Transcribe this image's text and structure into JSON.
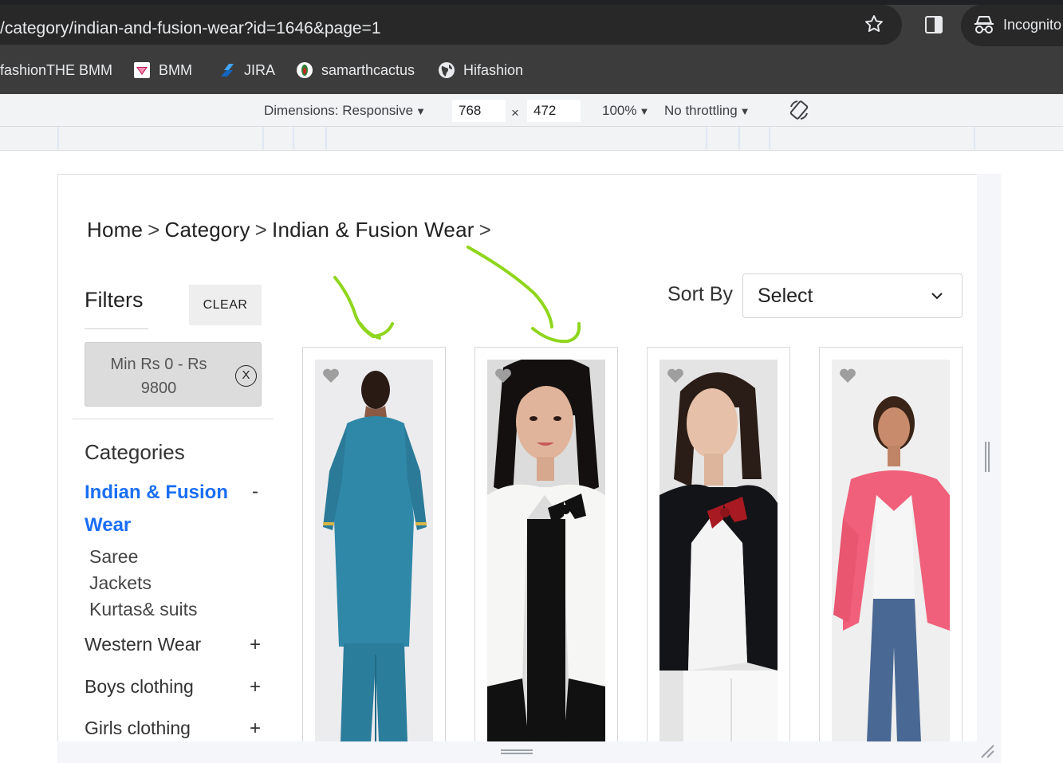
{
  "browser": {
    "url": "/category/indian-and-fusion-wear?id=1646&page=1",
    "incognito_label": "Incognito",
    "bookmarks": [
      {
        "label": "fashionTHE BMM"
      },
      {
        "label": "BMM"
      },
      {
        "label": "JIRA"
      },
      {
        "label": "samarthcactus"
      },
      {
        "label": "Hifashion"
      }
    ]
  },
  "devtools": {
    "dimensions_label": "Dimensions: Responsive",
    "width": "768",
    "times": "×",
    "height": "472",
    "zoom": "100%",
    "throttling": "No throttling"
  },
  "page": {
    "breadcrumb": [
      "Home",
      "Category",
      "Indian & Fusion Wear"
    ],
    "breadcrumb_sep": ">",
    "filters_title": "Filters",
    "clear_label": "CLEAR",
    "price_chip": "Min Rs 0 - Rs 9800",
    "chip_remove": "X",
    "categories_heading": "Categories",
    "active_category": "Indian & Fusion Wear",
    "active_toggle": "-",
    "subcategories": [
      "Saree",
      "Jackets",
      "Kurtas& suits"
    ],
    "categories": [
      {
        "label": "Western Wear",
        "toggle": "+"
      },
      {
        "label": "Boys clothing",
        "toggle": "+"
      },
      {
        "label": "Girls clothing",
        "toggle": "+"
      }
    ],
    "sort_label": "Sort By",
    "sort_value": "Select"
  },
  "colors": {
    "accent_blue": "#1a6ef5",
    "annotation_green": "#8fd61c",
    "kurta_teal": "#2f88a8",
    "jacket_pink": "#f0607a"
  }
}
